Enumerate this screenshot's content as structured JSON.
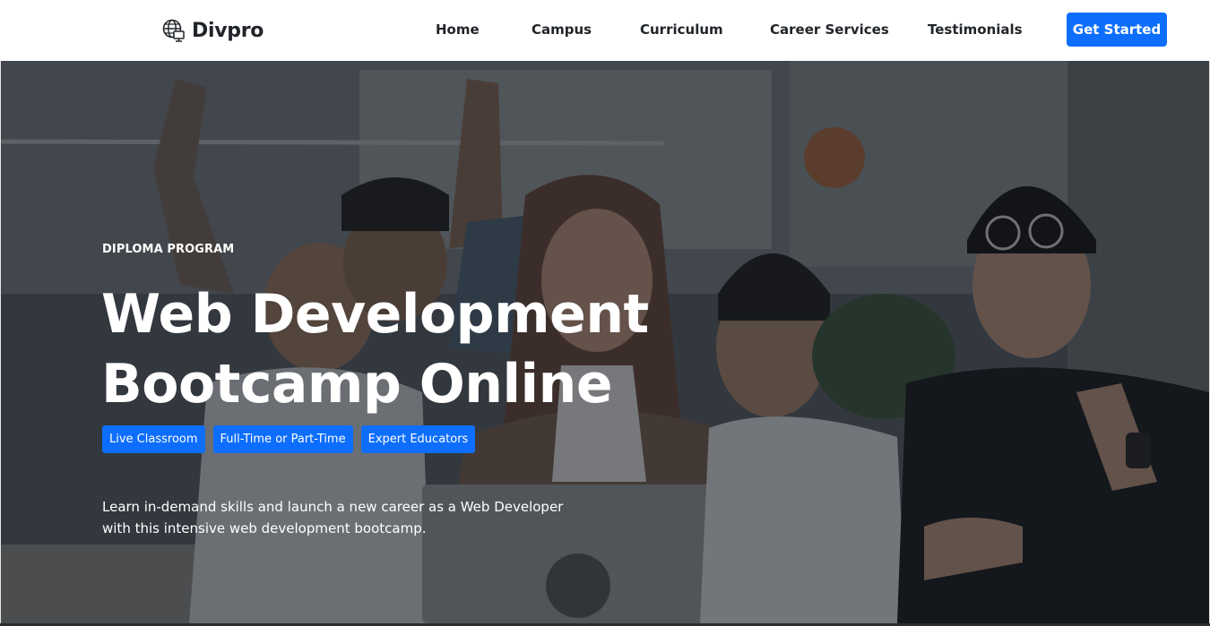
{
  "brand": {
    "name": "Divpro",
    "icon": "globe-icon"
  },
  "nav": {
    "items": [
      {
        "label": "Home"
      },
      {
        "label": "Campus"
      },
      {
        "label": "Curriculum"
      },
      {
        "label": "Career Services"
      },
      {
        "label": "Testimonials"
      }
    ],
    "cta_label": "Get Started"
  },
  "hero": {
    "eyebrow": "DIPLOMA PROGRAM",
    "title_line1": "Web Development",
    "title_line2": "Bootcamp Online",
    "badges": [
      {
        "label": "Live Classroom"
      },
      {
        "label": "Full-Time or Part-Time"
      },
      {
        "label": "Expert Educators"
      }
    ],
    "description_line1": "Learn in-demand skills and launch a new career as a Web Developer",
    "description_line2": "with this intensive web development bootcamp."
  },
  "colors": {
    "accent": "#0d6efd",
    "text_dark": "#212529",
    "hero_overlay": "#14181e"
  }
}
